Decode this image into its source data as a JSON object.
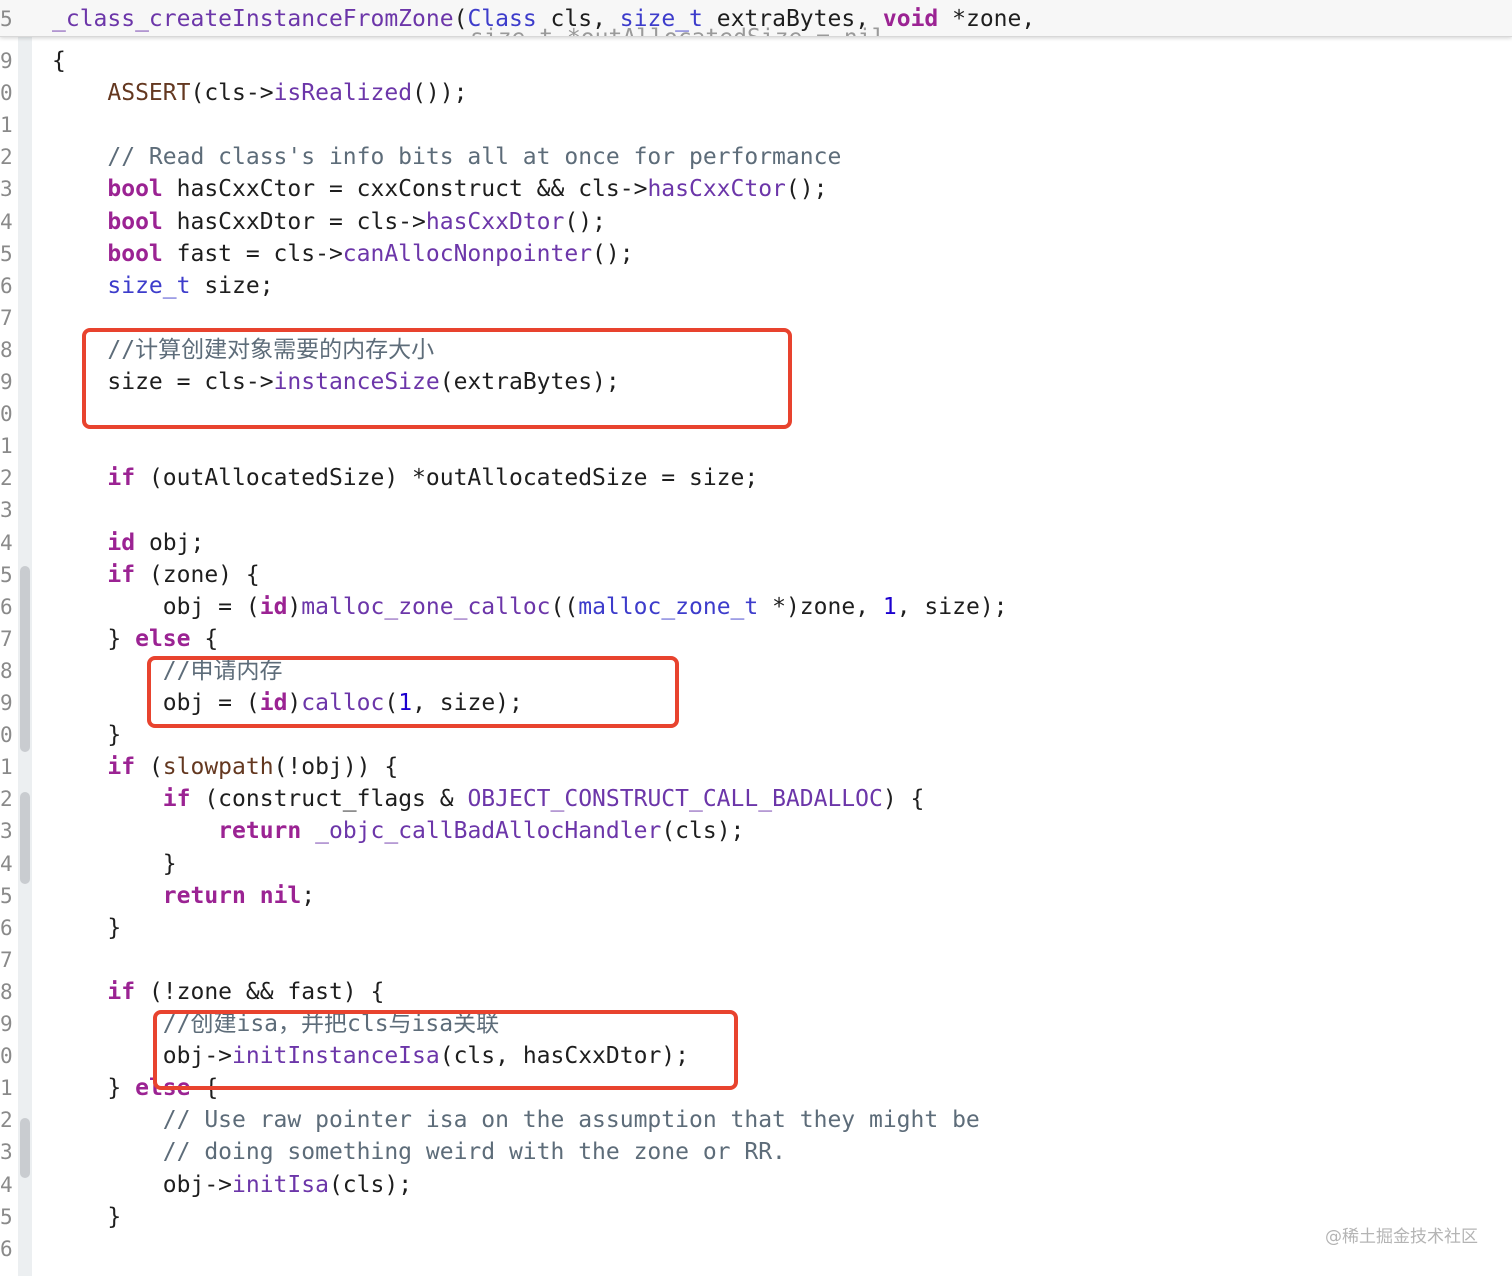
{
  "header": {
    "line_number": "5",
    "segments": [
      {
        "text": "_class_createInstanceFromZone",
        "style": "fn"
      },
      {
        "text": "(",
        "style": ""
      },
      {
        "text": "Class",
        "style": "typ"
      },
      {
        "text": " cls, ",
        "style": ""
      },
      {
        "text": "size_t",
        "style": "typ"
      },
      {
        "text": " extraBytes, ",
        "style": ""
      },
      {
        "text": "void",
        "style": "kw"
      },
      {
        "text": " *zone,",
        "style": ""
      }
    ],
    "ghost_text": "size_t *outAllocatedSize = nil,"
  },
  "gutter": {
    "line_numbers": [
      "9",
      "0",
      "1",
      "2",
      "3",
      "4",
      "5",
      "6",
      "7",
      "8",
      "9",
      "0",
      "1",
      "2",
      "3",
      "4",
      "5",
      "6",
      "7",
      "8",
      "9",
      "0",
      "1",
      "2",
      "3",
      "4",
      "5",
      "6",
      "7",
      "8",
      "9",
      "0",
      "1",
      "2",
      "3",
      "4",
      "5",
      "6"
    ]
  },
  "code_lines": [
    [
      {
        "t": "{",
        "c": ""
      }
    ],
    [
      {
        "t": "    ",
        "c": ""
      },
      {
        "t": "ASSERT",
        "c": "mac"
      },
      {
        "t": "(cls->",
        "c": ""
      },
      {
        "t": "isRealized",
        "c": "fn"
      },
      {
        "t": "());",
        "c": ""
      }
    ],
    [],
    [
      {
        "t": "    // Read class's info bits all at once for performance",
        "c": "cmt"
      }
    ],
    [
      {
        "t": "    ",
        "c": ""
      },
      {
        "t": "bool",
        "c": "kw"
      },
      {
        "t": " hasCxxCtor = cxxConstruct && cls->",
        "c": ""
      },
      {
        "t": "hasCxxCtor",
        "c": "fn"
      },
      {
        "t": "();",
        "c": ""
      }
    ],
    [
      {
        "t": "    ",
        "c": ""
      },
      {
        "t": "bool",
        "c": "kw"
      },
      {
        "t": " hasCxxDtor = cls->",
        "c": ""
      },
      {
        "t": "hasCxxDtor",
        "c": "fn"
      },
      {
        "t": "();",
        "c": ""
      }
    ],
    [
      {
        "t": "    ",
        "c": ""
      },
      {
        "t": "bool",
        "c": "kw"
      },
      {
        "t": " fast = cls->",
        "c": ""
      },
      {
        "t": "canAllocNonpointer",
        "c": "fn"
      },
      {
        "t": "();",
        "c": ""
      }
    ],
    [
      {
        "t": "    ",
        "c": ""
      },
      {
        "t": "size_t",
        "c": "typ"
      },
      {
        "t": " size;",
        "c": ""
      }
    ],
    [],
    [
      {
        "t": "    //计算创建对象需要的内存大小",
        "c": "cmt"
      }
    ],
    [
      {
        "t": "    size = cls->",
        "c": ""
      },
      {
        "t": "instanceSize",
        "c": "fn"
      },
      {
        "t": "(extraBytes);",
        "c": ""
      }
    ],
    [],
    [],
    [
      {
        "t": "    ",
        "c": ""
      },
      {
        "t": "if",
        "c": "kw"
      },
      {
        "t": " (outAllocatedSize) *outAllocatedSize = size;",
        "c": ""
      }
    ],
    [],
    [
      {
        "t": "    ",
        "c": ""
      },
      {
        "t": "id",
        "c": "kw"
      },
      {
        "t": " obj;",
        "c": ""
      }
    ],
    [
      {
        "t": "    ",
        "c": ""
      },
      {
        "t": "if",
        "c": "kw"
      },
      {
        "t": " (zone) {",
        "c": ""
      }
    ],
    [
      {
        "t": "        obj = (",
        "c": ""
      },
      {
        "t": "id",
        "c": "kw"
      },
      {
        "t": ")",
        "c": ""
      },
      {
        "t": "malloc_zone_calloc",
        "c": "fn"
      },
      {
        "t": "((",
        "c": ""
      },
      {
        "t": "malloc_zone_t",
        "c": "typ"
      },
      {
        "t": " *)zone, ",
        "c": ""
      },
      {
        "t": "1",
        "c": "num"
      },
      {
        "t": ", size);",
        "c": ""
      }
    ],
    [
      {
        "t": "    } ",
        "c": ""
      },
      {
        "t": "else",
        "c": "kw"
      },
      {
        "t": " {",
        "c": ""
      }
    ],
    [
      {
        "t": "        //申请内存",
        "c": "cmt"
      }
    ],
    [
      {
        "t": "        obj = (",
        "c": ""
      },
      {
        "t": "id",
        "c": "kw"
      },
      {
        "t": ")",
        "c": ""
      },
      {
        "t": "calloc",
        "c": "fn"
      },
      {
        "t": "(",
        "c": ""
      },
      {
        "t": "1",
        "c": "num"
      },
      {
        "t": ", size);",
        "c": ""
      }
    ],
    [
      {
        "t": "    }",
        "c": ""
      }
    ],
    [
      {
        "t": "    ",
        "c": ""
      },
      {
        "t": "if",
        "c": "kw"
      },
      {
        "t": " (",
        "c": ""
      },
      {
        "t": "slowpath",
        "c": "mac"
      },
      {
        "t": "(!obj)) {",
        "c": ""
      }
    ],
    [
      {
        "t": "        ",
        "c": ""
      },
      {
        "t": "if",
        "c": "kw"
      },
      {
        "t": " (construct_flags & ",
        "c": ""
      },
      {
        "t": "OBJECT_CONSTRUCT_CALL_BADALLOC",
        "c": "cst"
      },
      {
        "t": ") {",
        "c": ""
      }
    ],
    [
      {
        "t": "            ",
        "c": ""
      },
      {
        "t": "return",
        "c": "kw"
      },
      {
        "t": " ",
        "c": ""
      },
      {
        "t": "_objc_callBadAllocHandler",
        "c": "fn"
      },
      {
        "t": "(cls);",
        "c": ""
      }
    ],
    [
      {
        "t": "        }",
        "c": ""
      }
    ],
    [
      {
        "t": "        ",
        "c": ""
      },
      {
        "t": "return",
        "c": "kw"
      },
      {
        "t": " ",
        "c": ""
      },
      {
        "t": "nil",
        "c": "kw"
      },
      {
        "t": ";",
        "c": ""
      }
    ],
    [
      {
        "t": "    }",
        "c": ""
      }
    ],
    [],
    [
      {
        "t": "    ",
        "c": ""
      },
      {
        "t": "if",
        "c": "kw"
      },
      {
        "t": " (!zone && fast) {",
        "c": ""
      }
    ],
    [
      {
        "t": "        //创建isa，并把cls与isa关联",
        "c": "cmt"
      }
    ],
    [
      {
        "t": "        obj->",
        "c": ""
      },
      {
        "t": "initInstanceIsa",
        "c": "fn"
      },
      {
        "t": "(cls, hasCxxDtor);",
        "c": ""
      }
    ],
    [
      {
        "t": "    } ",
        "c": ""
      },
      {
        "t": "else",
        "c": "kw"
      },
      {
        "t": " {",
        "c": ""
      }
    ],
    [
      {
        "t": "        // Use raw pointer isa on the assumption that they might be",
        "c": "cmt"
      }
    ],
    [
      {
        "t": "        // doing something weird with the zone or RR.",
        "c": "cmt"
      }
    ],
    [
      {
        "t": "        obj->",
        "c": ""
      },
      {
        "t": "initIsa",
        "c": "fn"
      },
      {
        "t": "(cls);",
        "c": ""
      }
    ],
    [
      {
        "t": "    }",
        "c": ""
      }
    ],
    []
  ],
  "highlight_color": "#e8432e",
  "watermark": "@稀土掘金技术社区"
}
